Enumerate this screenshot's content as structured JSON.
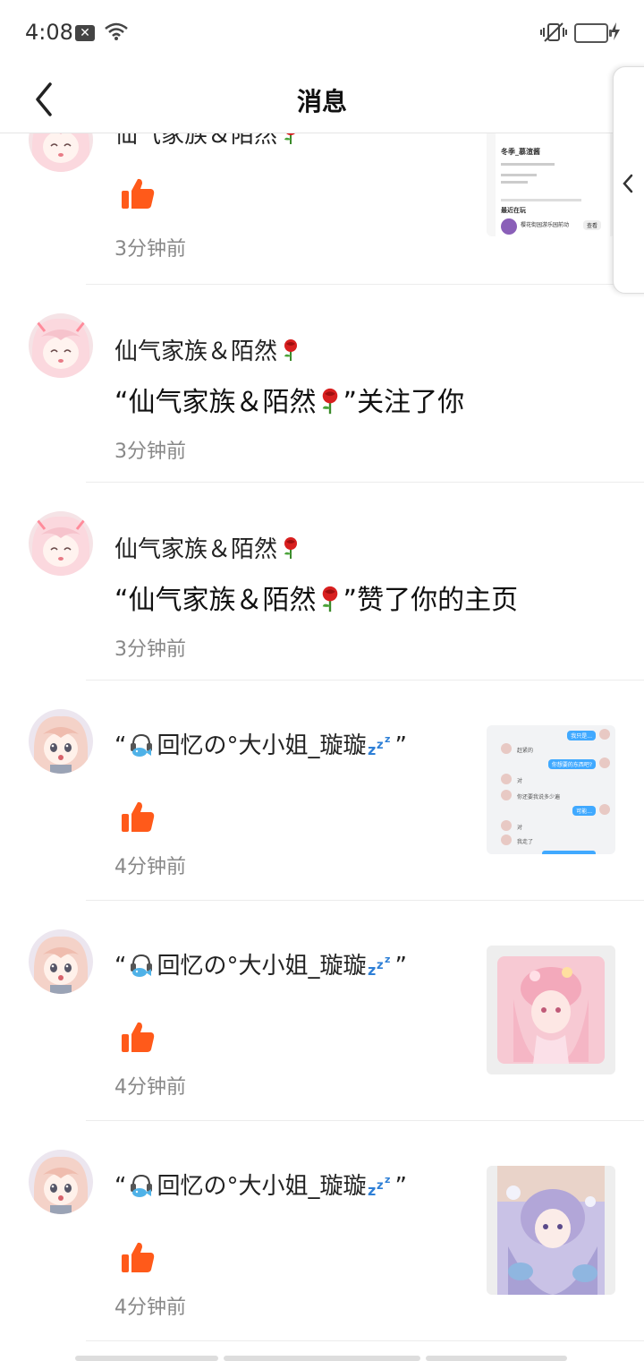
{
  "status_bar": {
    "time": "4:08",
    "icons": [
      "sim-off-icon",
      "wifi-icon",
      "vibrate-icon",
      "battery-icon",
      "charging-icon"
    ]
  },
  "header": {
    "title": "消息",
    "back_icon": "chevron-left-icon"
  },
  "side_handle": {
    "icon": "chevron-left-icon"
  },
  "colors": {
    "like": "#ff5a1a",
    "text_primary": "#111111",
    "text_secondary": "#888888",
    "divider": "#ececec"
  },
  "messages": [
    {
      "name": "仙气家族＆陌然",
      "type": "like",
      "time": "3分钟前",
      "thumbnail": "profile-screenshot",
      "thumb_text": {
        "user": "冬季_慕渲酱",
        "tab": "最近在玩",
        "item": "樱花街园游乐园前动",
        "btn": "查看"
      }
    },
    {
      "name": "仙气家族＆陌然",
      "content_prefix": "“仙气家族＆陌然",
      "content_suffix": "”关注了你",
      "time": "3分钟前"
    },
    {
      "name": "仙气家族＆陌然",
      "content_prefix": "“仙气家族＆陌然",
      "content_suffix": "”赞了你的主页",
      "time": "3分钟前"
    },
    {
      "name_open": "“",
      "name": "回忆の°大小姐_璇璇",
      "name_close": "”",
      "type": "like",
      "time": "4分钟前",
      "thumbnail": "chat-screenshot",
      "thumb_text": {
        "b1": "我只是...",
        "l1": "赶紧的",
        "b2": "你想要的东西吧?",
        "l2": "对",
        "l3": "你还要我说多少遍",
        "b3": "可能...",
        "l4": "对",
        "l5": "我走了"
      }
    },
    {
      "name_open": "“",
      "name": "回忆の°大小姐_璇璇",
      "name_close": "”",
      "type": "like",
      "time": "4分钟前",
      "thumbnail": "pink-anime-art"
    },
    {
      "name_open": "“",
      "name": "回忆の°大小姐_璇璇",
      "name_close": "”",
      "type": "like",
      "time": "4分钟前",
      "thumbnail": "purple-anime-art"
    }
  ]
}
